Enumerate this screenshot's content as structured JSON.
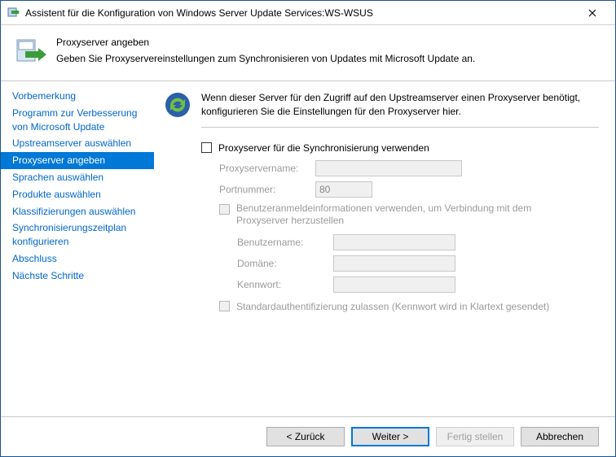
{
  "window": {
    "title": "Assistent für die Konfiguration von Windows Server Update Services:WS-WSUS"
  },
  "header": {
    "title": "Proxyserver angeben",
    "subtitle": "Geben Sie Proxyservereinstellungen zum Synchronisieren von Updates mit Microsoft Update an."
  },
  "sidebar": {
    "items": [
      {
        "label": "Vorbemerkung"
      },
      {
        "label": "Programm zur Verbesserung von Microsoft Update"
      },
      {
        "label": "Upstreamserver auswählen"
      },
      {
        "label": "Proxyserver angeben",
        "selected": true
      },
      {
        "label": "Sprachen auswählen"
      },
      {
        "label": "Produkte auswählen"
      },
      {
        "label": "Klassifizierungen auswählen"
      },
      {
        "label": "Synchronisierungszeitplan konfigurieren"
      },
      {
        "label": "Abschluss"
      },
      {
        "label": "Nächste Schritte"
      }
    ]
  },
  "content": {
    "description": "Wenn dieser Server für den Zugriff auf den Upstreamserver einen Proxyserver benötigt, konfigurieren Sie die Einstellungen für den Proxyserver hier.",
    "use_proxy_label": "Proxyserver für die Synchronisierung verwenden",
    "proxy_name_label": "Proxyservername:",
    "proxy_name_value": "",
    "port_label": "Portnummer:",
    "port_value": "80",
    "use_creds_label": "Benutzeranmeldeinformationen verwenden, um Verbindung mit dem Proxyserver herzustellen",
    "username_label": "Benutzername:",
    "username_value": "",
    "domain_label": "Domäne:",
    "domain_value": "",
    "password_label": "Kennwort:",
    "password_value": "",
    "basic_auth_label": "Standardauthentifizierung zulassen (Kennwort wird in Klartext gesendet)"
  },
  "footer": {
    "back": "< Zurück",
    "next": "Weiter >",
    "finish": "Fertig stellen",
    "cancel": "Abbrechen"
  }
}
